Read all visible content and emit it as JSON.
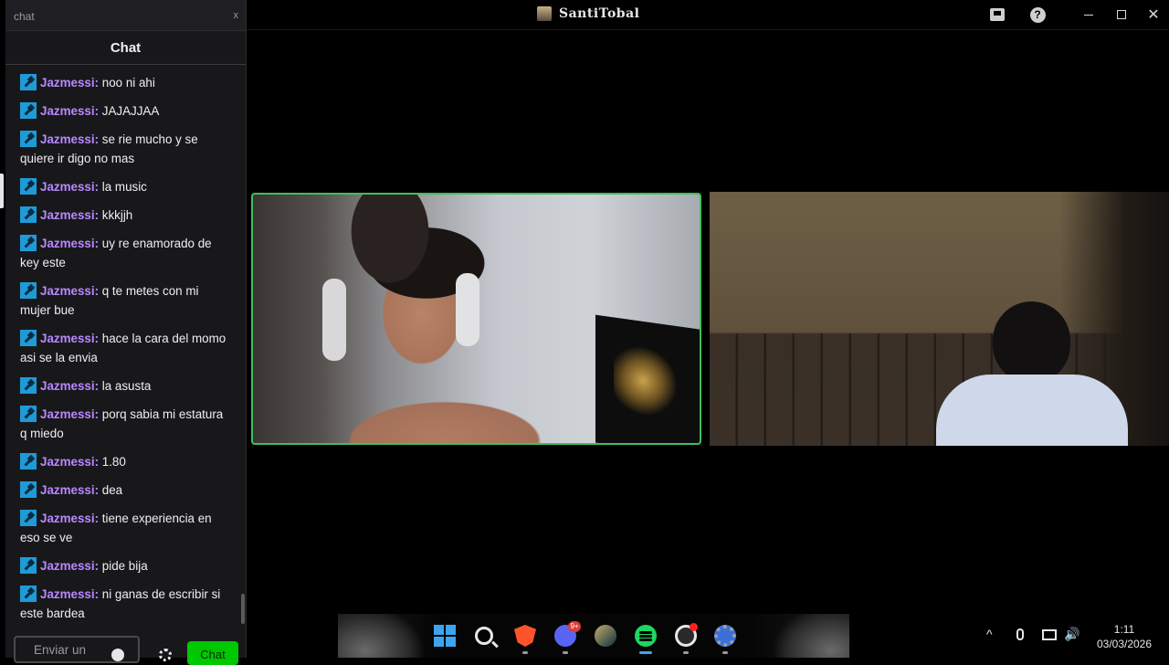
{
  "window": {
    "title": "SantiTobal",
    "icons": [
      "inbox-icon",
      "help-icon",
      "minimize-icon",
      "maximize-icon",
      "close-icon"
    ]
  },
  "chat": {
    "tab_name": "chat",
    "tab_close": "x",
    "header": "Chat",
    "messages": [
      {
        "user": "Jazmessi",
        "text": "noo ni ahi"
      },
      {
        "user": "Jazmessi",
        "text": "JAJAJJAA"
      },
      {
        "user": "Jazmessi",
        "text": "se rie mucho y se quiere ir digo no mas"
      },
      {
        "user": "Jazmessi",
        "text": "la music"
      },
      {
        "user": "Jazmessi",
        "text": "kkkjjh"
      },
      {
        "user": "Jazmessi",
        "text": "uy re enamorado de key este"
      },
      {
        "user": "Jazmessi",
        "text": "q te metes con mi mujer bue"
      },
      {
        "user": "Jazmessi",
        "text": "hace la cara del momo asi se la envia"
      },
      {
        "user": "Jazmessi",
        "text": "la asusta"
      },
      {
        "user": "Jazmessi",
        "text": "porq sabia mi estatura q miedo"
      },
      {
        "user": "Jazmessi",
        "text": "1.80"
      },
      {
        "user": "Jazmessi",
        "text": "dea"
      },
      {
        "user": "Jazmessi",
        "text": "tiene experiencia en eso se ve"
      },
      {
        "user": "Jazmessi",
        "text": "pide bija"
      },
      {
        "user": "Jazmessi",
        "text": "ni ganas de escribir si este bardea"
      }
    ],
    "input_placeholder": "Enviar un",
    "send_label": "Chat"
  },
  "taskbar": {
    "apps": [
      "windows-start-icon",
      "search-icon",
      "brave-browser-icon",
      "discord-icon",
      "league-of-legends-icon",
      "spotify-icon",
      "obs-icon",
      "settings-icon"
    ],
    "discord_badge": "9+",
    "clock_time": "1:11",
    "clock_date": "03/03/2026",
    "tray_up": "^",
    "tray_volume": "🔊"
  },
  "colors": {
    "username": "#b988ff",
    "badge": "#1e9bd7",
    "send_button": "#00c800",
    "active_speaker_border": "#3fbf5a"
  }
}
